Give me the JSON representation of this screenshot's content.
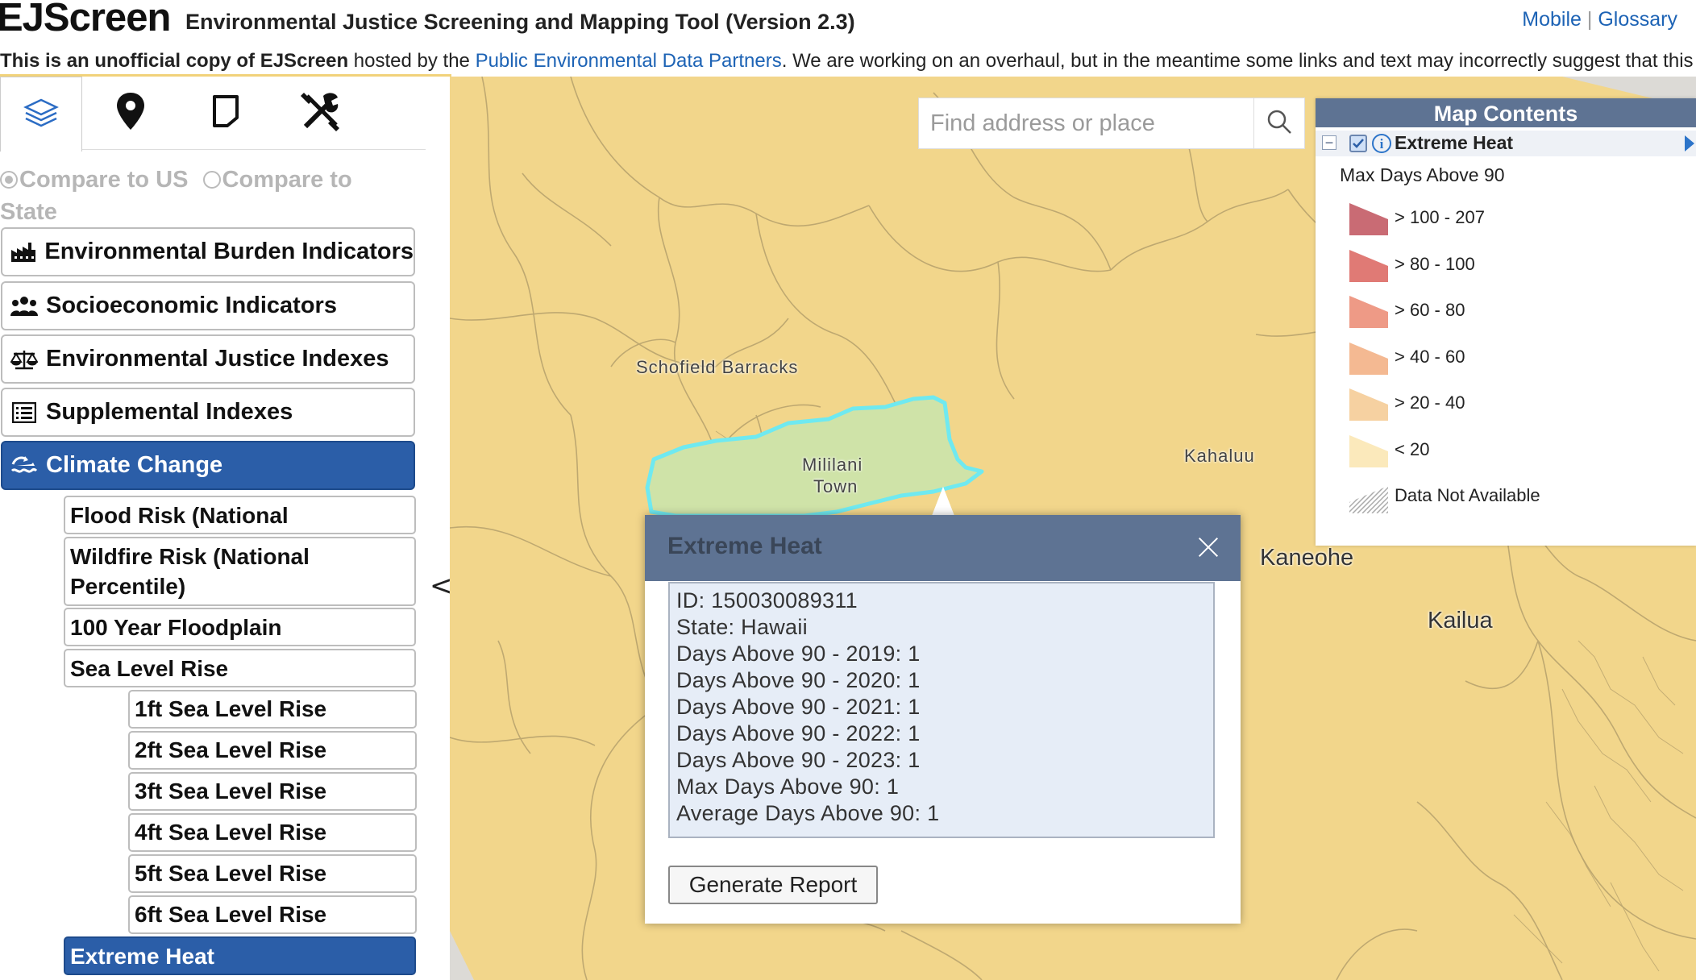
{
  "header": {
    "logo": "EJScreen",
    "subtitle": "Environmental Justice Screening and Mapping Tool (Version 2.3)",
    "links": {
      "mobile": "Mobile",
      "separator": "|",
      "glossary": "Glossary"
    }
  },
  "banner": {
    "bold": "This is an unofficial copy of EJScreen",
    "pre_link": " hosted by the ",
    "link": "Public Environmental Data Partners",
    "post_link": ". We are working on an overhaul, but in the meantime some links and text may incorrectly suggest that this"
  },
  "left_panel": {
    "tabs": [
      {
        "icon": "layers-icon"
      },
      {
        "icon": "map-pin-icon"
      },
      {
        "icon": "bookmark-icon"
      },
      {
        "icon": "tools-icon"
      }
    ],
    "compare": {
      "us": "Compare to US",
      "state": "Compare to State",
      "selected": "us"
    },
    "categories": {
      "env_burden": "Environmental Burden Indicators",
      "socio": "Socioeconomic Indicators",
      "ej_indexes": "Environmental Justice Indexes",
      "supplemental": "Supplemental Indexes",
      "climate": "Climate Change"
    },
    "climate_items": {
      "flood": "Flood Risk (National Percentile)",
      "wildfire": "Wildfire Risk (National Percentile)",
      "floodplain": "100 Year Floodplain",
      "sea_level": "Sea Level Rise",
      "slr1": "1ft Sea Level Rise",
      "slr2": "2ft Sea Level Rise",
      "slr3": "3ft Sea Level Rise",
      "slr4": "4ft Sea Level Rise",
      "slr5": "5ft Sea Level Rise",
      "slr6": "6ft Sea Level Rise",
      "heat": "Extreme Heat"
    },
    "collapse": "<"
  },
  "map": {
    "search_placeholder": "Find address or place",
    "places": {
      "schofield": "Schofield Barracks",
      "mililani_1": "Mililani",
      "mililani_2": "Town",
      "kahaluu": "Kahaluu",
      "kaneohe": "Kaneohe",
      "kailua": "Kailua"
    }
  },
  "legend": {
    "title": "Map Contents",
    "layer_name": "Extreme Heat",
    "layer_checked": true,
    "field": "Max Days Above 90",
    "classes": [
      {
        "label": "> 100 - 207",
        "color": "#c96b74"
      },
      {
        "label": "> 80 - 100",
        "color": "#e07a75"
      },
      {
        "label": "> 60 - 80",
        "color": "#ee9a86"
      },
      {
        "label": "> 40 - 60",
        "color": "#f4b992"
      },
      {
        "label": "> 20 - 40",
        "color": "#f6d1a1"
      },
      {
        "label": "< 20",
        "color": "#fbe9bb"
      },
      {
        "label": "Data Not Available",
        "color": "hatched"
      }
    ]
  },
  "popup": {
    "title": "Extreme Heat",
    "lines": [
      "ID: 150030089311",
      "State: Hawaii",
      "Days Above 90 - 2019: 1",
      "Days Above 90 - 2020: 1",
      "Days Above 90 - 2021: 1",
      "Days Above 90 - 2022: 1",
      "Days Above 90 - 2023: 1",
      "Max Days Above 90: 1",
      "Average Days Above 90: 1"
    ],
    "button": "Generate Report"
  },
  "colors": {
    "accent": "#2b5ea8",
    "header_blue": "#5e7393",
    "map_fill": "#f2d68b",
    "selected_tract": "#cfe3a8",
    "selected_outline": "#6fe9f0"
  }
}
